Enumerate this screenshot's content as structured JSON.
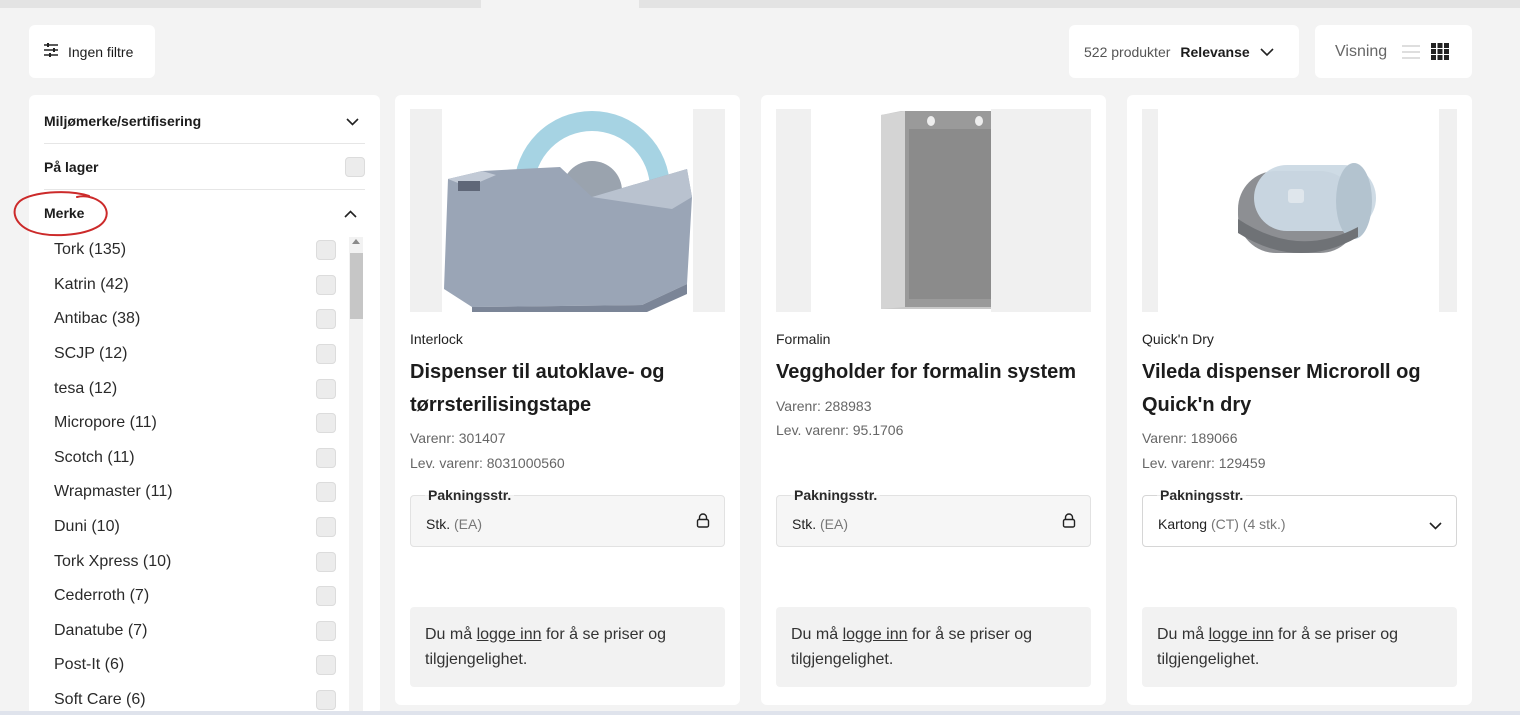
{
  "toolbar": {
    "filters_label": "Ingen filtre",
    "count_label": "522 produkter",
    "sort_label": "Relevanse",
    "view_label": "Visning"
  },
  "sidebar": {
    "sections": [
      {
        "label": "Miljømerke/sertifisering"
      },
      {
        "label": "På lager"
      },
      {
        "label": "Merke"
      }
    ],
    "brands": [
      "Tork (135)",
      "Katrin (42)",
      "Antibac (38)",
      "SCJP (12)",
      "tesa (12)",
      "Micropore (11)",
      "Scotch (11)",
      "Wrapmaster (11)",
      "Duni (10)",
      "Tork Xpress (10)",
      "Cederroth (7)",
      "Danatube (7)",
      "Post-It (6)",
      "Soft Care (6)"
    ]
  },
  "products": [
    {
      "brand": "Interlock",
      "title": "Dispenser til autoklave- og tørrsterilisingstape",
      "varenr": "Varenr: 301407",
      "lev_varenr": "Lev. varenr: 8031000560",
      "pack_label": "Pakningsstr.",
      "pack_unit": "Stk.",
      "pack_code": "(EA)",
      "login_prefix": "Du må",
      "login_link": "logge inn",
      "login_suffix": "for å se priser og tilgjengelighet."
    },
    {
      "brand": "Formalin",
      "title": "Veggholder for formalin system",
      "varenr": "Varenr: 288983",
      "lev_varenr": "Lev. varenr: 95.1706",
      "pack_label": "Pakningsstr.",
      "pack_unit": "Stk.",
      "pack_code": "(EA)",
      "login_prefix": "Du må",
      "login_link": "logge inn",
      "login_suffix": "for å se priser og tilgjengelighet."
    },
    {
      "brand": "Quick'n Dry",
      "title": "Vileda dispenser Microroll og Quick'n dry",
      "varenr": "Varenr: 189066",
      "lev_varenr": "Lev. varenr: 129459",
      "pack_label": "Pakningsstr.",
      "pack_unit": "Kartong",
      "pack_code": "(CT) (4 stk.)",
      "login_prefix": "Du må",
      "login_link": "logge inn",
      "login_suffix": "for å se priser og tilgjengelighet."
    }
  ]
}
